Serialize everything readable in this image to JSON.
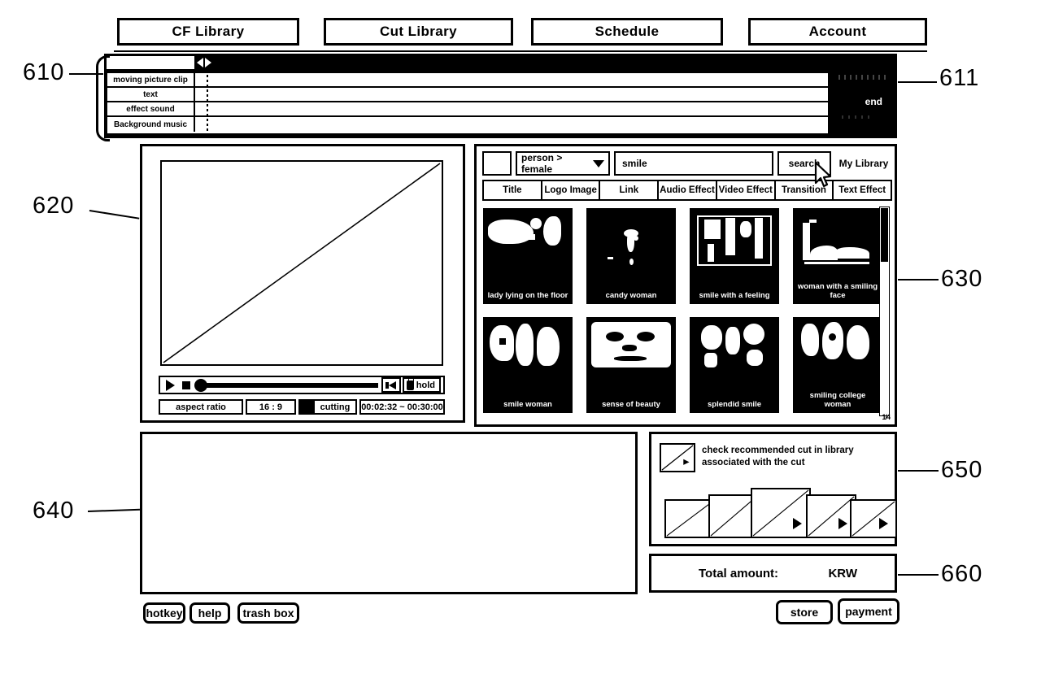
{
  "nav": {
    "tabs": [
      {
        "label": "CF Library"
      },
      {
        "label": "Cut Library"
      },
      {
        "label": "Schedule"
      },
      {
        "label": "Account"
      }
    ]
  },
  "callouts": [
    {
      "id": "610",
      "text": "610"
    },
    {
      "id": "611",
      "text": "611"
    },
    {
      "id": "620",
      "text": "620"
    },
    {
      "id": "630",
      "text": "630"
    },
    {
      "id": "640",
      "text": "640"
    },
    {
      "id": "650",
      "text": "650"
    },
    {
      "id": "660",
      "text": "660"
    }
  ],
  "timeline": {
    "tracks": [
      {
        "label": "moving picture clip"
      },
      {
        "label": "text"
      },
      {
        "label": "effect sound"
      },
      {
        "label": "Background music"
      }
    ],
    "end_marker": "end"
  },
  "preview": {
    "controls": {
      "play_icon": "play-icon",
      "stop_icon": "stop-icon",
      "speaker_icon": "speaker-icon",
      "hold_label": "hold",
      "lock_icon": "lock-icon"
    },
    "status": {
      "aspect_ratio_label": "aspect ratio",
      "aspect_ratio_value": "16 : 9",
      "cutting_label": "cutting",
      "time_range": "00:02:32 ~ 00:30:00"
    }
  },
  "library": {
    "search": {
      "category": "person > female",
      "query": "smile",
      "query_placeholder": "smile",
      "search_label": "search",
      "my_library_label": "My Library",
      "dropdown_icon": "chevron-down-icon",
      "cursor_icon": "mouse-cursor-icon"
    },
    "tabs": [
      {
        "label": "Title"
      },
      {
        "label": "Logo Image"
      },
      {
        "label": "Link"
      },
      {
        "label": "Audio Effect"
      },
      {
        "label": "Video Effect"
      },
      {
        "label": "Transition"
      },
      {
        "label": "Text Effect"
      }
    ],
    "thumbnails": [
      {
        "caption": "lady lying on the floor"
      },
      {
        "caption": "candy woman"
      },
      {
        "caption": "smile with a feeling"
      },
      {
        "caption": "woman with a smiling face"
      },
      {
        "caption": "smile woman"
      },
      {
        "caption": "sense of beauty"
      },
      {
        "caption": "splendid smile"
      },
      {
        "caption": "smiling college woman"
      }
    ],
    "corner_mark": "1/4"
  },
  "recommended": {
    "text_line1": "check recommended cut in library",
    "text_line2": "associated with the cut",
    "frames": [
      {
        "has_play": false
      },
      {
        "has_play": false
      },
      {
        "has_play": true
      },
      {
        "has_play": true
      },
      {
        "has_play": true
      }
    ]
  },
  "total": {
    "label": "Total amount:",
    "currency": "KRW"
  },
  "bottom_buttons": {
    "hotkey": "hotkey",
    "help": "help",
    "trash_box": "trash box",
    "store": "store",
    "payment": "payment"
  },
  "colors": {
    "ink": "#000000",
    "paper": "#ffffff"
  }
}
